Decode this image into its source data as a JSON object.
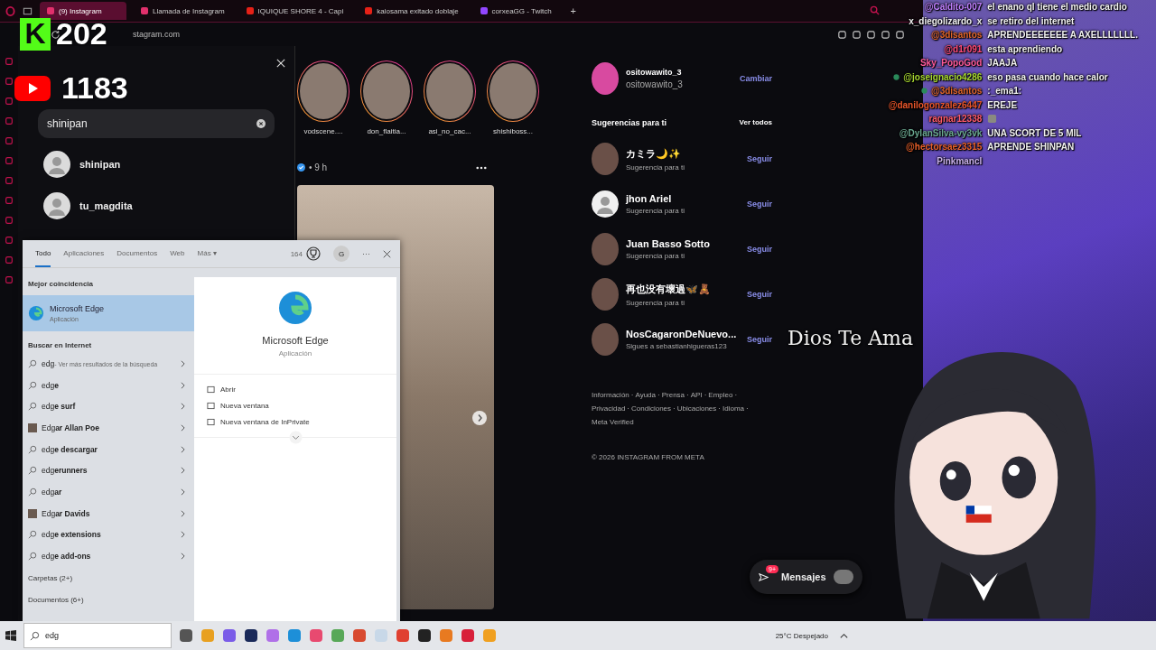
{
  "browser": {
    "tabs": [
      {
        "label": "(9) Instagram",
        "selected": true
      },
      {
        "label": "Llamada de Instagram",
        "selected": false
      },
      {
        "label": "IQUIQUE SHORE 4 - Capi",
        "selected": false
      },
      {
        "label": "kaiosama exitado doblaje",
        "selected": false
      },
      {
        "label": "corxeaGG - Twitch",
        "selected": false
      }
    ],
    "new_tab": "+",
    "url": "stagram.com"
  },
  "search_panel": {
    "query": "shinipan",
    "results": [
      {
        "name": "shinipan"
      },
      {
        "name": "tu_magdita"
      }
    ]
  },
  "stories": [
    {
      "name": "vodscene...."
    },
    {
      "name": "don_flaitia..."
    },
    {
      "name": "asi_no_cac..."
    },
    {
      "name": "shishiboss..."
    }
  ],
  "post": {
    "time": "• 9 h"
  },
  "profile": {
    "username": "ositowawito_3",
    "name": "ositowawito_3",
    "switch": "Cambiar"
  },
  "suggestions": {
    "title": "Sugerencias para ti",
    "see_all": "Ver todos",
    "items": [
      {
        "name": "カミラ🌙✨",
        "sub": "Sugerencia para ti",
        "action": "Seguir",
        "default_avatar": false
      },
      {
        "name": "jhon Ariel",
        "sub": "Sugerencia para ti",
        "action": "Seguir",
        "default_avatar": true
      },
      {
        "name": "Juan Basso Sotto",
        "sub": "Sugerencia para ti",
        "action": "Seguir",
        "default_avatar": false
      },
      {
        "name": "再也没有壞過🦋🧸",
        "sub": "Sugerencia para ti",
        "action": "Seguir",
        "default_avatar": false
      },
      {
        "name": "NosCagaronDeNuevo...",
        "sub": "Sigues a sebastianhigueras123",
        "action": "Seguir",
        "default_avatar": false
      }
    ]
  },
  "footer": {
    "links": [
      "Información",
      "Ayuda",
      "Prensa",
      "API",
      "Empleo",
      "Privacidad",
      "Condiciones",
      "Ubicaciones",
      "Idioma",
      "Meta Verified"
    ],
    "separator": "·",
    "copyright": "© 2026 INSTAGRAM FROM META"
  },
  "messages": {
    "label": "Mensajes",
    "badge": "9+"
  },
  "windows_search": {
    "tabs": [
      {
        "label": "Todo",
        "selected": true
      },
      {
        "label": "Aplicaciones",
        "selected": false
      },
      {
        "label": "Documentos",
        "selected": false
      },
      {
        "label": "Web",
        "selected": false
      },
      {
        "label": "Más ▾",
        "selected": false
      }
    ],
    "points": "164",
    "account": "G",
    "more": "···",
    "best_match_heading": "Mejor coincidencia",
    "best_match": {
      "name": "Microsoft Edge",
      "type": "Aplicación"
    },
    "web_heading": "Buscar en Internet",
    "results": [
      {
        "kind": "search",
        "text": "edg",
        "hint": "- Ver más resultados de la búsqueda"
      },
      {
        "kind": "search",
        "text": "edg**e**"
      },
      {
        "kind": "search",
        "text": "edg**e surf**"
      },
      {
        "kind": "person",
        "text": "Edg**ar Allan Poe**"
      },
      {
        "kind": "search",
        "text": "edg**e descargar**"
      },
      {
        "kind": "search",
        "text": "edg**erunners**"
      },
      {
        "kind": "search",
        "text": "edg**ar**"
      },
      {
        "kind": "person",
        "text": "Edg**ar Davids**"
      },
      {
        "kind": "search",
        "text": "edg**e extensions**"
      },
      {
        "kind": "search",
        "text": "edg**e add-ons**"
      }
    ],
    "sections": [
      "Carpetas (2+)",
      "Documentos (6+)"
    ],
    "preview": {
      "name": "Microsoft Edge",
      "type": "Aplicación",
      "actions": [
        "Abrir",
        "Nueva ventana",
        "Nueva ventana de InPrivate"
      ]
    }
  },
  "taskbar": {
    "search_value": "edg",
    "weather": "25°C Despejado"
  },
  "stream_overlay": {
    "kick_logo": "K",
    "kick_viewers": "202",
    "youtube_viewers": "1183",
    "banner": "Dios Te Ama"
  },
  "chat": [
    {
      "user": "@Caldito-007",
      "color": "#c080ff",
      "message": "el enano ql tiene el medio cardio",
      "badge": false
    },
    {
      "user": "x_diegolizardo_x",
      "color": "#f2f2f2",
      "message": "se retiro del internet",
      "badge": false
    },
    {
      "user": "@3disantos",
      "color": "#e0652a",
      "message": "APRENDEEEEEEE A AXELLLLLLL.",
      "badge": false
    },
    {
      "user": "@d1r091",
      "color": "#ff4a78",
      "message": "esta aprendiendo",
      "badge": false
    },
    {
      "user": "Sky_PopoGod",
      "color": "#ff5a9a",
      "message": "JAAJA",
      "badge": false
    },
    {
      "user": "@joseignacio4286",
      "color": "#a6d630",
      "message": "eso pasa cuando hace calor",
      "badge": true
    },
    {
      "user": "@3disantos",
      "color": "#e0652a",
      "message": ":_ema1:",
      "badge": true
    },
    {
      "user": "@danilogonzalez6447",
      "color": "#e8552a",
      "message": "EREJE",
      "badge": false
    },
    {
      "user": "ragnar12338",
      "color": "#ff5a6a",
      "badge": false
    },
    {
      "user": "@DylanSilva-vy3vk",
      "color": "#6aa890",
      "message": "UNA SCORT DE 5 MIL",
      "badge": false
    },
    {
      "user": "@hectorsaez3315",
      "color": "#e8602a",
      "message": "APRENDE SHINPAN",
      "badge": false
    },
    {
      "user": "Pinkmancl",
      "color": "#c8b0e8",
      "badge": false
    }
  ]
}
